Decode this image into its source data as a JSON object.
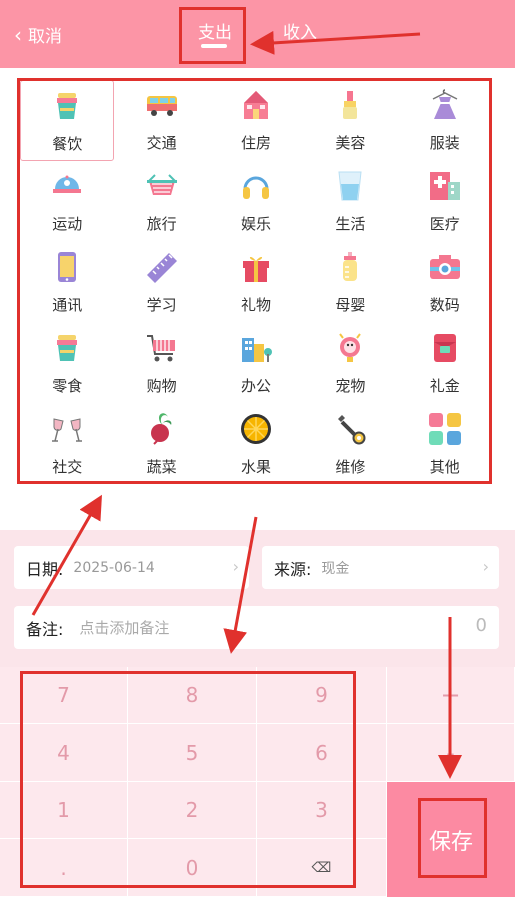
{
  "header": {
    "cancel_label": "取消",
    "tabs": [
      {
        "label": "支出",
        "active": true
      },
      {
        "label": "收入",
        "active": false
      }
    ]
  },
  "categories": [
    {
      "label": "餐饮",
      "icon": "drink-cup-icon",
      "selected": true
    },
    {
      "label": "交通",
      "icon": "bus-icon"
    },
    {
      "label": "住房",
      "icon": "house-icon"
    },
    {
      "label": "美容",
      "icon": "lipstick-icon"
    },
    {
      "label": "服装",
      "icon": "dress-icon"
    },
    {
      "label": "运动",
      "icon": "cap-icon"
    },
    {
      "label": "旅行",
      "icon": "basket-icon"
    },
    {
      "label": "娱乐",
      "icon": "headphones-icon"
    },
    {
      "label": "生活",
      "icon": "glass-icon"
    },
    {
      "label": "医疗",
      "icon": "hospital-icon"
    },
    {
      "label": "通讯",
      "icon": "phone-icon"
    },
    {
      "label": "学习",
      "icon": "ruler-icon"
    },
    {
      "label": "礼物",
      "icon": "gift-icon"
    },
    {
      "label": "母婴",
      "icon": "baby-bottle-icon"
    },
    {
      "label": "数码",
      "icon": "camera-icon"
    },
    {
      "label": "零食",
      "icon": "snack-cup-icon"
    },
    {
      "label": "购物",
      "icon": "shopping-cart-icon"
    },
    {
      "label": "办公",
      "icon": "office-building-icon"
    },
    {
      "label": "宠物",
      "icon": "pet-icon"
    },
    {
      "label": "礼金",
      "icon": "red-envelope-icon"
    },
    {
      "label": "社交",
      "icon": "wine-glasses-icon"
    },
    {
      "label": "蔬菜",
      "icon": "radish-icon"
    },
    {
      "label": "水果",
      "icon": "orange-slice-icon"
    },
    {
      "label": "维修",
      "icon": "wrench-icon"
    },
    {
      "label": "其他",
      "icon": "grid-squares-icon"
    }
  ],
  "form": {
    "date_label": "日期:",
    "date_value": "2025-06-14",
    "source_label": "来源:",
    "source_value": "现金",
    "note_label": "备注:",
    "note_placeholder": "点击添加备注",
    "amount": "0"
  },
  "keypad": {
    "keys": [
      "7",
      "8",
      "9",
      "+",
      "4",
      "5",
      "6",
      "-",
      "1",
      "2",
      "3",
      ".",
      "0",
      "⌫"
    ],
    "save_label": "保存"
  },
  "colors": {
    "header_bg": "#fc95a6",
    "save_bg": "#fc8aa2",
    "annotation_red": "#e0312d",
    "keypad_bg": "#fde8ed"
  }
}
